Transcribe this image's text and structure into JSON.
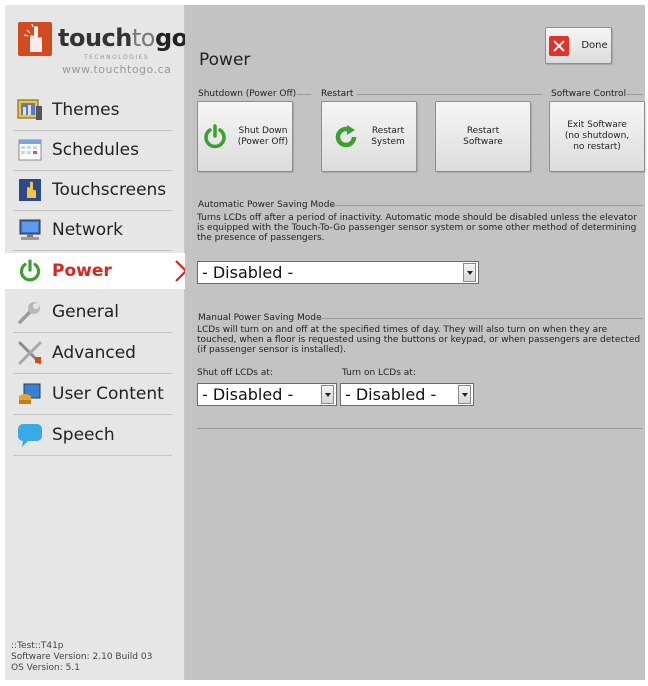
{
  "logo": {
    "brand_touch": "touch",
    "brand_to": "to",
    "brand_go": "go",
    "tagline": "TECHNOLOGIES",
    "site": "www.touchtogo.ca"
  },
  "sidebar": {
    "items": [
      {
        "label": "Themes",
        "icon": "themes-icon"
      },
      {
        "label": "Schedules",
        "icon": "calendar-icon"
      },
      {
        "label": "Touchscreens",
        "icon": "touch-hand-icon"
      },
      {
        "label": "Network",
        "icon": "monitor-icon"
      },
      {
        "label": "Power",
        "icon": "power-icon",
        "active": true
      },
      {
        "label": "General",
        "icon": "wrench-icon"
      },
      {
        "label": "Advanced",
        "icon": "tools-icon"
      },
      {
        "label": "User Content",
        "icon": "user-content-icon"
      },
      {
        "label": "Speech",
        "icon": "speech-bubble-icon"
      }
    ],
    "version_lines": [
      "::Test::T41p",
      "Software Version: 2.10 Build 03",
      "OS Version: 5.1"
    ]
  },
  "main": {
    "title": "Power",
    "done_label": "Done",
    "groups": {
      "shutdown": "Shutdown (Power Off)",
      "restart": "Restart",
      "software_control": "Software Control"
    },
    "buttons": {
      "shutdown_line1": "Shut Down",
      "shutdown_line2": "(Power Off)",
      "restart_system_line1": "Restart",
      "restart_system_line2": "System",
      "restart_software_line1": "Restart",
      "restart_software_line2": "Software",
      "exit_line1": "Exit Software",
      "exit_line2": "(no shutdown,",
      "exit_line3": "no restart)"
    },
    "auto_mode": {
      "label": "Automatic Power Saving Mode",
      "description": "Turns LCDs off after a period of inactivity.  Automatic mode should be disabled unless the elevator is equipped with the Touch-To-Go passenger sensor system or some other method of determining the presence of passengers.",
      "selected": "- Disabled -"
    },
    "manual_mode": {
      "label": "Manual Power Saving Mode",
      "description": "LCDs will turn on and off at the specified times of day.  They will also turn on when they are touched, when a floor is requested using the buttons or keypad, or when passengers are detected (if passenger sensor is installed).",
      "shut_off_label": "Shut off LCDs at:",
      "turn_on_label": "Turn on LCDs at:",
      "shut_off_selected": "- Disabled -",
      "turn_on_selected": "- Disabled -"
    }
  },
  "colors": {
    "accent_red": "#d8261f",
    "power_green": "#3aa02f",
    "panel_gray": "#c3c3c3",
    "sidebar_gray": "#e6e6e6"
  }
}
